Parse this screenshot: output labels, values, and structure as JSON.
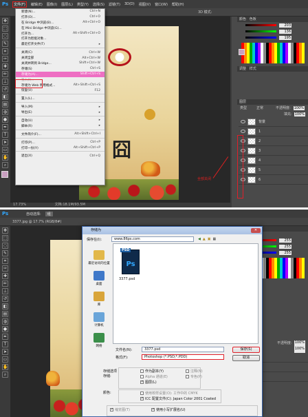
{
  "top": {
    "menubar": [
      "文件(F)",
      "编辑(E)",
      "图像(I)",
      "图层(L)",
      "类型(Y)",
      "选择(S)",
      "滤镜(T)",
      "3D(D)",
      "视图(V)",
      "窗口(W)",
      "帮助(H)"
    ],
    "workspace": "3D 模式:",
    "file_menu": [
      {
        "label": "新建(N)...",
        "key": "Ctrl+N"
      },
      {
        "label": "打开(O)...",
        "key": "Ctrl+O"
      },
      {
        "label": "在 Bridge 中浏览(B)...",
        "key": "Alt+Ctrl+O"
      },
      {
        "label": "在 Mini Bridge 中浏览(G)...",
        "key": ""
      },
      {
        "label": "打开为...",
        "key": "Alt+Shift+Ctrl+O"
      },
      {
        "label": "打开为智能对象...",
        "key": ""
      },
      {
        "label": "最近打开文件(T)",
        "key": "▸"
      },
      {
        "sep": true
      },
      {
        "label": "关闭(C)",
        "key": "Ctrl+W"
      },
      {
        "label": "关闭全部",
        "key": "Alt+Ctrl+W"
      },
      {
        "label": "关闭并转到 Bridge...",
        "key": "Shift+Ctrl+W"
      },
      {
        "label": "存储(S)",
        "key": "Ctrl+S"
      },
      {
        "label": "存储为(A)...",
        "key": "Shift+Ctrl+S",
        "selected": true
      },
      {
        "label": "签入(I)...",
        "key": "",
        "disabled": true
      },
      {
        "label": "存储为 Web 所用格式...",
        "key": "Alt+Shift+Ctrl+S"
      },
      {
        "label": "恢复(V)",
        "key": "F12"
      },
      {
        "sep": true
      },
      {
        "label": "置入(L)...",
        "key": ""
      },
      {
        "sep": true
      },
      {
        "label": "导入(M)",
        "key": "▸"
      },
      {
        "label": "导出(E)",
        "key": "▸"
      },
      {
        "sep": true
      },
      {
        "label": "自动(U)",
        "key": "▸"
      },
      {
        "label": "脚本(R)",
        "key": "▸"
      },
      {
        "sep": true
      },
      {
        "label": "文件简介(F)...",
        "key": "Alt+Shift+Ctrl+I"
      },
      {
        "sep": true
      },
      {
        "label": "打印(P)...",
        "key": "Ctrl+P"
      },
      {
        "label": "打印一份(Y)",
        "key": "Alt+Shift+Ctrl+P"
      },
      {
        "sep": true
      },
      {
        "label": "退出(X)",
        "key": "Ctrl+Q"
      }
    ],
    "zoom": "17.73%",
    "doc_info": "文档:18.1M/93.5M",
    "annotation": "全部关闭",
    "color_values": [
      "203",
      "136",
      "195"
    ],
    "opacity_label": "不透明度:",
    "opacity_value": "100%",
    "fill_label": "填充:",
    "fill_value": "100%",
    "layer_names": [
      "背景",
      "1",
      "2",
      "3",
      "4",
      "5",
      "6"
    ],
    "panel_tabs": [
      "颜色",
      "色板"
    ],
    "layers_tab": "图层",
    "adjust_tab": "调整",
    "style_tab": "样式",
    "blend_mode": "正常",
    "kind_label": "类型"
  },
  "bottom": {
    "doc_tab": "3377.jpg @ 17.7% (RGB/8#)",
    "opt_auto": "自动选择:",
    "opt_group": "组",
    "dialog": {
      "title": "存储为",
      "save_in_label": "保存在(I):",
      "save_in_value": "www.86ps.com",
      "nav": [
        "最近访问的位置",
        "桌面",
        "库",
        "计算机",
        "网络"
      ],
      "file_label": "3377.psd",
      "psd_tag": "PSD",
      "ps_mark": "Ps",
      "filename_label": "文件名(N):",
      "filename_value": "3377.psd",
      "format_label": "格式(F):",
      "format_value": "Photoshop (*.PSD;*.PDD)",
      "save_btn": "保存(S)",
      "cancel_btn": "取消",
      "store_options_label": "存储选项",
      "store_label": "存储:",
      "as_copy": "作为副本(Y)",
      "notes": "注释(N)",
      "alpha": "Alpha 通道(E)",
      "spot": "专色(P)",
      "layers": "图层(L)",
      "color_label": "颜色:",
      "proof": "使用校样设置(O): 工作中的 CMYK",
      "icc": "ICC 配置文件(C): Japan Color 2001 Coated",
      "thumbnail": "缩览图(T)",
      "lowercase": "使用小写扩展名(U)"
    },
    "color_values": [
      "255",
      "255",
      "255"
    ],
    "opacity_label": "不透明度:",
    "opacity_value": "100%",
    "fill_value": "100%"
  },
  "colors": {
    "accent": "#e0202a",
    "ps_blue": "#31a8ff",
    "menu_highlight": "#ee6fc3"
  }
}
